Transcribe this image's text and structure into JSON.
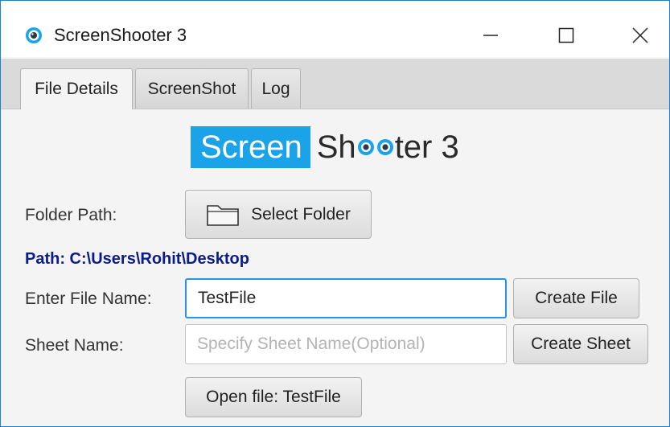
{
  "window": {
    "title": "ScreenShooter 3"
  },
  "tabs": [
    {
      "label": "File Details",
      "active": true
    },
    {
      "label": "ScreenShot",
      "active": false
    },
    {
      "label": "Log",
      "active": false
    }
  ],
  "logo": {
    "boxed_word": "Screen",
    "rest_prefix": "Sh",
    "rest_suffix": "ter 3",
    "brand_color": "#1aa3e8"
  },
  "folder": {
    "label": "Folder Path:",
    "button_label": "Select Folder",
    "path_text": "Path: C:\\Users\\Rohit\\Desktop"
  },
  "file": {
    "label": "Enter File Name:",
    "value": "TestFile",
    "button_label": "Create File"
  },
  "sheet": {
    "label": "Sheet Name:",
    "placeholder": "Specify Sheet Name(Optional)",
    "value": "",
    "button_label": "Create Sheet"
  },
  "open_file": {
    "button_label": "Open file: TestFile"
  },
  "colors": {
    "accent": "#1aa3e8",
    "path_text": "#0a1c8c",
    "focus_border": "#2a93e6"
  }
}
